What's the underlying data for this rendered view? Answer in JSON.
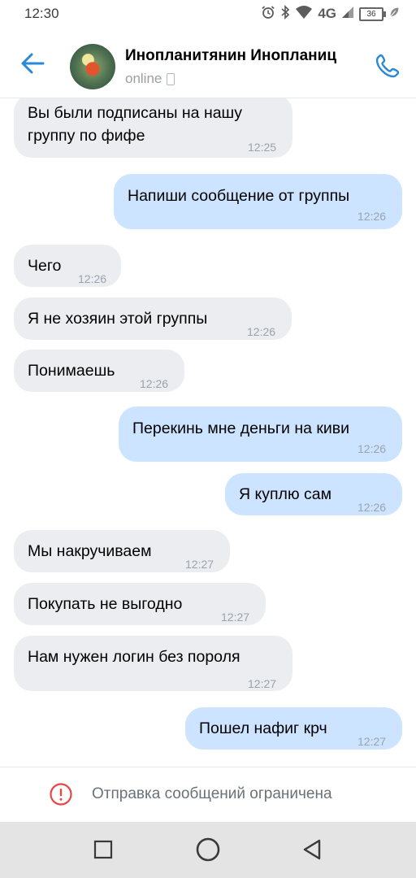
{
  "status_bar": {
    "time": "12:30",
    "network": "4G",
    "battery": "36"
  },
  "header": {
    "contact_name": "Инопланитянин Инопланиц",
    "status": "online"
  },
  "messages": [
    {
      "side": "in",
      "text_lines": [
        "Вы были подписаны на нашу",
        "группу по фифе"
      ],
      "time": "12:25"
    },
    {
      "side": "out",
      "text_lines": [
        "Напиши сообщение от группы"
      ],
      "time": "12:26"
    },
    {
      "side": "in",
      "text_lines": [
        "Чего"
      ],
      "time": "12:26"
    },
    {
      "side": "in",
      "text_lines": [
        "Я не хозяин этой группы"
      ],
      "time": "12:26"
    },
    {
      "side": "in",
      "text_lines": [
        "Понимаешь"
      ],
      "time": "12:26"
    },
    {
      "side": "out",
      "text_lines": [
        "Перекинь мне деньги на киви"
      ],
      "time": "12:26"
    },
    {
      "side": "out",
      "text_lines": [
        "Я куплю сам"
      ],
      "time": "12:26"
    },
    {
      "side": "in",
      "text_lines": [
        "Мы накручиваем"
      ],
      "time": "12:27"
    },
    {
      "side": "in",
      "text_lines": [
        "Покупать не выгодно"
      ],
      "time": "12:27"
    },
    {
      "side": "in",
      "text_lines": [
        "Нам нужен логин без пороля"
      ],
      "time": "12:27"
    },
    {
      "side": "out",
      "text_lines": [
        "Пошел нафиг крч"
      ],
      "time": "12:27"
    }
  ],
  "restriction": {
    "text": "Отправка сообщений ограничена"
  },
  "colors": {
    "accent": "#2a88d8",
    "incoming_bubble": "#ebedf0",
    "outgoing_bubble": "#cce4ff",
    "warning": "#e64646"
  },
  "icons": {
    "back": "arrow-left-icon",
    "call": "phone-icon",
    "warning": "exclamation-circle-icon",
    "nav": [
      "square-icon",
      "circle-icon",
      "triangle-back-icon"
    ]
  }
}
